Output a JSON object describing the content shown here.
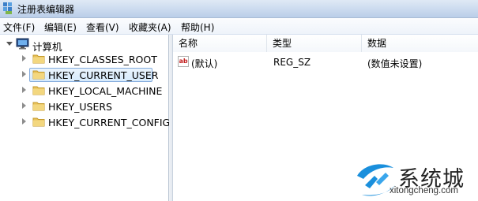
{
  "window": {
    "title": "注册表编辑器"
  },
  "menu": [
    "文件(F)",
    "编辑(E)",
    "查看(V)",
    "收藏夹(A)",
    "帮助(H)"
  ],
  "tree": {
    "root": "计算机",
    "items": [
      "HKEY_CLASSES_ROOT",
      "HKEY_CURRENT_USER",
      "HKEY_LOCAL_MACHINE",
      "HKEY_USERS",
      "HKEY_CURRENT_CONFIG"
    ],
    "selected": "HKEY_CURRENT_USER"
  },
  "list": {
    "columns": [
      "名称",
      "类型",
      "数据"
    ],
    "rows": [
      {
        "name": "(默认)",
        "type": "REG_SZ",
        "data": "(数值未设置)"
      }
    ]
  },
  "watermark": {
    "name": "系统城",
    "url": "xitongcheng.com"
  },
  "colors": {
    "selection": "#d6eafb",
    "selection_border": "#84acdd",
    "folder": "#e8c15a",
    "watermark_blue": "#1a8fdc"
  }
}
